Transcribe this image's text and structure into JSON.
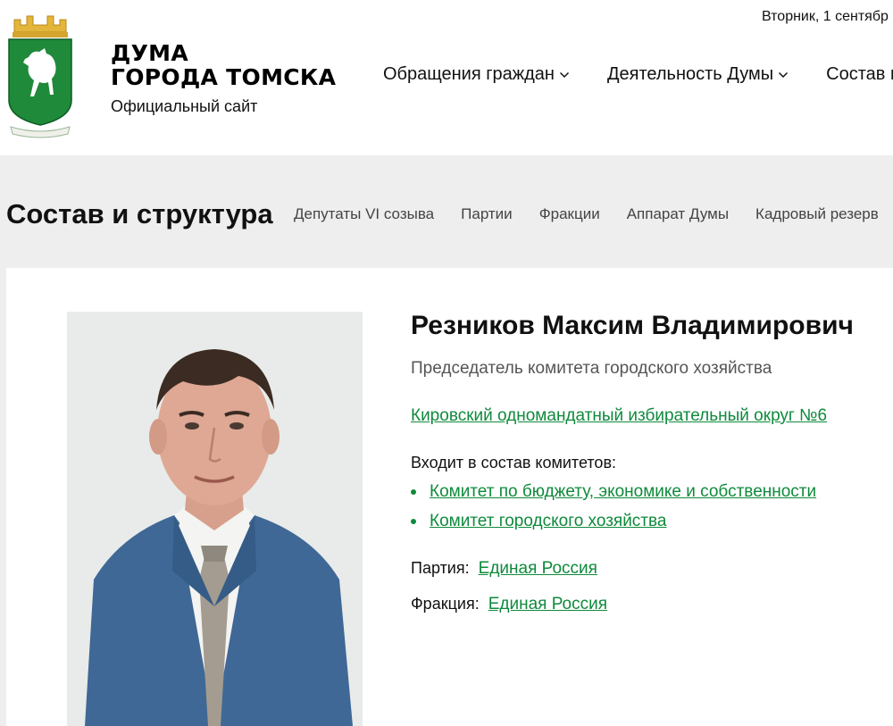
{
  "header": {
    "date": "Вторник, 1 сентябр",
    "brand_line1": "ДУМА",
    "brand_line2": "ГОРОДА ТОМСКА",
    "brand_sub": "Официальный сайт",
    "nav": [
      {
        "label": "Обращения граждан"
      },
      {
        "label": "Деятельность Думы"
      },
      {
        "label": "Состав и"
      }
    ]
  },
  "section": {
    "title": "Состав и структура",
    "subnav": [
      {
        "label": "Депутаты VI созыва"
      },
      {
        "label": "Партии"
      },
      {
        "label": "Фракции"
      },
      {
        "label": "Аппарат Думы"
      },
      {
        "label": "Кадровый резерв"
      }
    ]
  },
  "person": {
    "name": "Резников Максим Владимирович",
    "role": "Председатель комитета городского хозяйства",
    "district": "Кировский одномандатный избирательный округ №6",
    "committees_label": "Входит в состав комитетов:",
    "committees": [
      {
        "label": "Комитет по бюджету, экономике и собственности"
      },
      {
        "label": "Комитет городского хозяйства"
      }
    ],
    "party_label": "Партия:",
    "party": "Единая Россия",
    "faction_label": "Фракция:",
    "faction": "Единая Россия"
  },
  "colors": {
    "link": "#0f8a3c",
    "section_bg": "#eeeeee",
    "crest_green": "#1f8a3a",
    "crest_gold": "#e3b53a"
  },
  "icons": {
    "logo": "tomsk-coat-of-arms-icon",
    "nav_dropdown": "chevron-down-icon",
    "bullet": "bullet-icon"
  }
}
